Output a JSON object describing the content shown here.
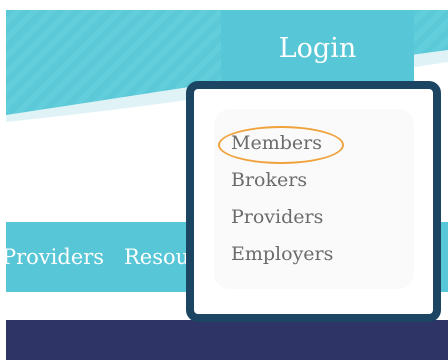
{
  "header": {
    "login_label": "Login"
  },
  "nav": {
    "items": [
      {
        "label": "Providers"
      },
      {
        "label": "Resources"
      }
    ]
  },
  "login_menu": {
    "items": [
      {
        "label": "Members",
        "highlighted": true
      },
      {
        "label": "Brokers"
      },
      {
        "label": "Providers"
      },
      {
        "label": "Employers"
      }
    ]
  },
  "colors": {
    "header_teal": "#5cc9d8",
    "login_tab": "#57c6d6",
    "dropdown_border": "#1b4562",
    "highlight_oval": "#f0a23c",
    "dark_band": "#2e3566",
    "menu_text": "#6b6b6b"
  }
}
